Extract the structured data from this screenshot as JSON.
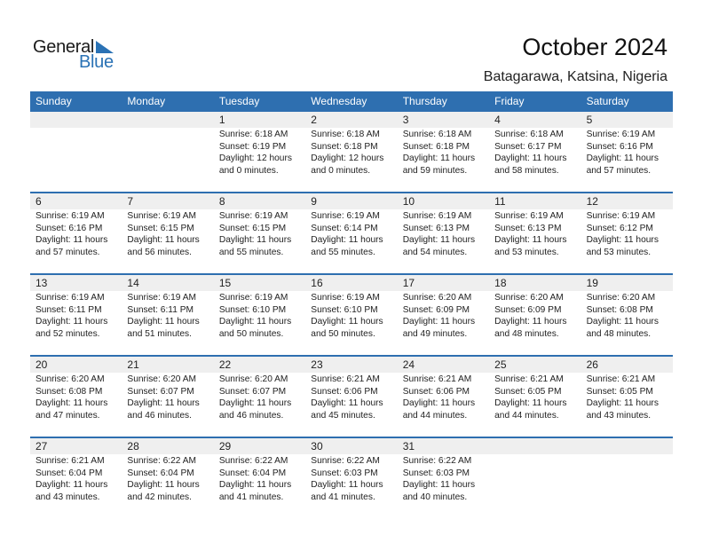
{
  "logo": {
    "word1": "General",
    "word2": "Blue",
    "brand_color": "#2a72b5"
  },
  "header": {
    "title": "October 2024",
    "location": "Batagarawa, Katsina, Nigeria"
  },
  "colors": {
    "header_bg": "#2e6fb0",
    "daynum_bg": "#efefef"
  },
  "weekdays": [
    "Sunday",
    "Monday",
    "Tuesday",
    "Wednesday",
    "Thursday",
    "Friday",
    "Saturday"
  ],
  "weeks": [
    [
      null,
      null,
      {
        "day": "1",
        "sunrise": "Sunrise: 6:18 AM",
        "sunset": "Sunset: 6:19 PM",
        "daylight1": "Daylight: 12 hours",
        "daylight2": "and 0 minutes."
      },
      {
        "day": "2",
        "sunrise": "Sunrise: 6:18 AM",
        "sunset": "Sunset: 6:18 PM",
        "daylight1": "Daylight: 12 hours",
        "daylight2": "and 0 minutes."
      },
      {
        "day": "3",
        "sunrise": "Sunrise: 6:18 AM",
        "sunset": "Sunset: 6:18 PM",
        "daylight1": "Daylight: 11 hours",
        "daylight2": "and 59 minutes."
      },
      {
        "day": "4",
        "sunrise": "Sunrise: 6:18 AM",
        "sunset": "Sunset: 6:17 PM",
        "daylight1": "Daylight: 11 hours",
        "daylight2": "and 58 minutes."
      },
      {
        "day": "5",
        "sunrise": "Sunrise: 6:19 AM",
        "sunset": "Sunset: 6:16 PM",
        "daylight1": "Daylight: 11 hours",
        "daylight2": "and 57 minutes."
      }
    ],
    [
      {
        "day": "6",
        "sunrise": "Sunrise: 6:19 AM",
        "sunset": "Sunset: 6:16 PM",
        "daylight1": "Daylight: 11 hours",
        "daylight2": "and 57 minutes."
      },
      {
        "day": "7",
        "sunrise": "Sunrise: 6:19 AM",
        "sunset": "Sunset: 6:15 PM",
        "daylight1": "Daylight: 11 hours",
        "daylight2": "and 56 minutes."
      },
      {
        "day": "8",
        "sunrise": "Sunrise: 6:19 AM",
        "sunset": "Sunset: 6:15 PM",
        "daylight1": "Daylight: 11 hours",
        "daylight2": "and 55 minutes."
      },
      {
        "day": "9",
        "sunrise": "Sunrise: 6:19 AM",
        "sunset": "Sunset: 6:14 PM",
        "daylight1": "Daylight: 11 hours",
        "daylight2": "and 55 minutes."
      },
      {
        "day": "10",
        "sunrise": "Sunrise: 6:19 AM",
        "sunset": "Sunset: 6:13 PM",
        "daylight1": "Daylight: 11 hours",
        "daylight2": "and 54 minutes."
      },
      {
        "day": "11",
        "sunrise": "Sunrise: 6:19 AM",
        "sunset": "Sunset: 6:13 PM",
        "daylight1": "Daylight: 11 hours",
        "daylight2": "and 53 minutes."
      },
      {
        "day": "12",
        "sunrise": "Sunrise: 6:19 AM",
        "sunset": "Sunset: 6:12 PM",
        "daylight1": "Daylight: 11 hours",
        "daylight2": "and 53 minutes."
      }
    ],
    [
      {
        "day": "13",
        "sunrise": "Sunrise: 6:19 AM",
        "sunset": "Sunset: 6:11 PM",
        "daylight1": "Daylight: 11 hours",
        "daylight2": "and 52 minutes."
      },
      {
        "day": "14",
        "sunrise": "Sunrise: 6:19 AM",
        "sunset": "Sunset: 6:11 PM",
        "daylight1": "Daylight: 11 hours",
        "daylight2": "and 51 minutes."
      },
      {
        "day": "15",
        "sunrise": "Sunrise: 6:19 AM",
        "sunset": "Sunset: 6:10 PM",
        "daylight1": "Daylight: 11 hours",
        "daylight2": "and 50 minutes."
      },
      {
        "day": "16",
        "sunrise": "Sunrise: 6:19 AM",
        "sunset": "Sunset: 6:10 PM",
        "daylight1": "Daylight: 11 hours",
        "daylight2": "and 50 minutes."
      },
      {
        "day": "17",
        "sunrise": "Sunrise: 6:20 AM",
        "sunset": "Sunset: 6:09 PM",
        "daylight1": "Daylight: 11 hours",
        "daylight2": "and 49 minutes."
      },
      {
        "day": "18",
        "sunrise": "Sunrise: 6:20 AM",
        "sunset": "Sunset: 6:09 PM",
        "daylight1": "Daylight: 11 hours",
        "daylight2": "and 48 minutes."
      },
      {
        "day": "19",
        "sunrise": "Sunrise: 6:20 AM",
        "sunset": "Sunset: 6:08 PM",
        "daylight1": "Daylight: 11 hours",
        "daylight2": "and 48 minutes."
      }
    ],
    [
      {
        "day": "20",
        "sunrise": "Sunrise: 6:20 AM",
        "sunset": "Sunset: 6:08 PM",
        "daylight1": "Daylight: 11 hours",
        "daylight2": "and 47 minutes."
      },
      {
        "day": "21",
        "sunrise": "Sunrise: 6:20 AM",
        "sunset": "Sunset: 6:07 PM",
        "daylight1": "Daylight: 11 hours",
        "daylight2": "and 46 minutes."
      },
      {
        "day": "22",
        "sunrise": "Sunrise: 6:20 AM",
        "sunset": "Sunset: 6:07 PM",
        "daylight1": "Daylight: 11 hours",
        "daylight2": "and 46 minutes."
      },
      {
        "day": "23",
        "sunrise": "Sunrise: 6:21 AM",
        "sunset": "Sunset: 6:06 PM",
        "daylight1": "Daylight: 11 hours",
        "daylight2": "and 45 minutes."
      },
      {
        "day": "24",
        "sunrise": "Sunrise: 6:21 AM",
        "sunset": "Sunset: 6:06 PM",
        "daylight1": "Daylight: 11 hours",
        "daylight2": "and 44 minutes."
      },
      {
        "day": "25",
        "sunrise": "Sunrise: 6:21 AM",
        "sunset": "Sunset: 6:05 PM",
        "daylight1": "Daylight: 11 hours",
        "daylight2": "and 44 minutes."
      },
      {
        "day": "26",
        "sunrise": "Sunrise: 6:21 AM",
        "sunset": "Sunset: 6:05 PM",
        "daylight1": "Daylight: 11 hours",
        "daylight2": "and 43 minutes."
      }
    ],
    [
      {
        "day": "27",
        "sunrise": "Sunrise: 6:21 AM",
        "sunset": "Sunset: 6:04 PM",
        "daylight1": "Daylight: 11 hours",
        "daylight2": "and 43 minutes."
      },
      {
        "day": "28",
        "sunrise": "Sunrise: 6:22 AM",
        "sunset": "Sunset: 6:04 PM",
        "daylight1": "Daylight: 11 hours",
        "daylight2": "and 42 minutes."
      },
      {
        "day": "29",
        "sunrise": "Sunrise: 6:22 AM",
        "sunset": "Sunset: 6:04 PM",
        "daylight1": "Daylight: 11 hours",
        "daylight2": "and 41 minutes."
      },
      {
        "day": "30",
        "sunrise": "Sunrise: 6:22 AM",
        "sunset": "Sunset: 6:03 PM",
        "daylight1": "Daylight: 11 hours",
        "daylight2": "and 41 minutes."
      },
      {
        "day": "31",
        "sunrise": "Sunrise: 6:22 AM",
        "sunset": "Sunset: 6:03 PM",
        "daylight1": "Daylight: 11 hours",
        "daylight2": "and 40 minutes."
      },
      null,
      null
    ]
  ]
}
